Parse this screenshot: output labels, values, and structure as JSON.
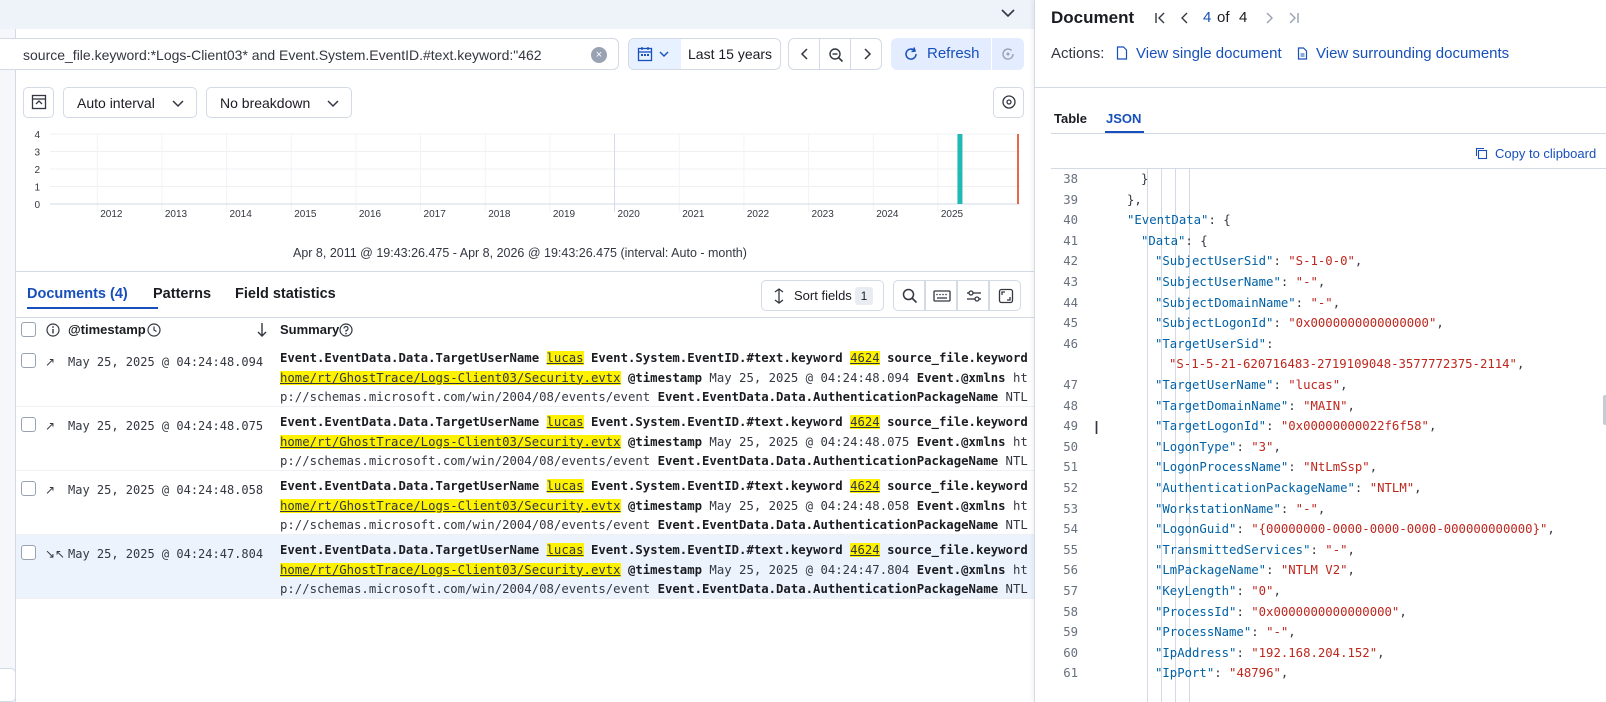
{
  "query": {
    "text": "source_file.keyword:*Logs-Client03* and Event.System.EventID.#text.keyword:\"462",
    "clear_symbol": "×"
  },
  "date": {
    "label": "Last 15 years"
  },
  "refresh": {
    "label": "Refresh"
  },
  "toolbar": {
    "interval": "Auto interval",
    "breakdown": "No breakdown"
  },
  "chart_data": {
    "type": "bar",
    "y_ticks": [
      "4",
      "3",
      "2",
      "1",
      "0"
    ],
    "categories": [
      "2012",
      "2013",
      "2014",
      "2015",
      "2016",
      "2017",
      "2018",
      "2019",
      "2020",
      "2021",
      "2022",
      "2023",
      "2024",
      "2025"
    ],
    "ylim": [
      0,
      4
    ],
    "bar": {
      "at": "2025-05",
      "value": 4,
      "color": "#20b9b4"
    },
    "now_marker_color": "#e7664c",
    "range_text": "Apr 8, 2011 @ 19:43:26.475 - Apr 8, 2026 @ 19:43:26.475 (interval: Auto - month)"
  },
  "tabs": {
    "documents": "Documents (4)",
    "patterns": "Patterns",
    "field_stats": "Field statistics"
  },
  "sort": {
    "label": "Sort fields",
    "count": "1"
  },
  "table": {
    "col_timestamp": "@timestamp",
    "col_summary": "Summary",
    "rows": [
      {
        "ts": "May 25, 2025 @ 04:24:48.094",
        "selected": false
      },
      {
        "ts": "May 25, 2025 @ 04:24:48.075",
        "selected": false
      },
      {
        "ts": "May 25, 2025 @ 04:24:48.058",
        "selected": false
      },
      {
        "ts": "May 25, 2025 @ 04:24:47.804",
        "selected": true
      }
    ],
    "summary": {
      "f1": "Event.EventData.Data.TargetUserName",
      "v1": "lucas",
      "f2": "Event.System.EventID.#text.keyword",
      "v2": "4624",
      "f3": "source_file.keyword",
      "v3a": "/",
      "v3b": "home/rt/GhostTrace/Logs-Client03/Security.evtx",
      "f4": "@timestamp",
      "f5": "Event.@xmlns",
      "v5a": "htt",
      "v5b": "p://schemas.microsoft.com/win/2004/08/events/event",
      "f6": "Event.EventData.Data.AuthenticationPackageName",
      "v6": "NTLM..."
    }
  },
  "flyout": {
    "title": "Document",
    "pager_current": "4",
    "pager_of": "of",
    "pager_total": "4",
    "actions_label": "Actions:",
    "view_single": "View single document",
    "view_surrounding": "View surrounding documents",
    "tab_table": "Table",
    "tab_json": "JSON",
    "copy": "Copy to clipboard"
  },
  "json_lines": [
    {
      "n": "38",
      "indent": 2,
      "text": "}"
    },
    {
      "n": "39",
      "indent": 1,
      "text": "},"
    },
    {
      "n": "40",
      "indent": 1,
      "key": "\"EventData\"",
      "rest": ": {"
    },
    {
      "n": "41",
      "indent": 2,
      "key": "\"Data\"",
      "rest": ": {"
    },
    {
      "n": "42",
      "indent": 3,
      "key": "\"SubjectUserSid\"",
      "val": "\"S-1-0-0\""
    },
    {
      "n": "43",
      "indent": 3,
      "key": "\"SubjectUserName\"",
      "val": "\"-\""
    },
    {
      "n": "44",
      "indent": 3,
      "key": "\"SubjectDomainName\"",
      "val": "\"-\""
    },
    {
      "n": "45",
      "indent": 3,
      "key": "\"SubjectLogonId\"",
      "val": "\"0x0000000000000000\""
    },
    {
      "n": "46",
      "indent": 3,
      "key": "\"TargetUserSid\"",
      "rest": ":"
    },
    {
      "n": "",
      "indent": 4,
      "valonly": "\"S-1-5-21-620716483-2719109048-3577772375-2114\""
    },
    {
      "n": "47",
      "indent": 3,
      "key": "\"TargetUserName\"",
      "val": "\"lucas\""
    },
    {
      "n": "48",
      "indent": 3,
      "key": "\"TargetDomainName\"",
      "val": "\"MAIN\""
    },
    {
      "n": "49",
      "indent": 3,
      "key": "\"TargetLogonId\"",
      "val": "\"0x00000000022f6f58\""
    },
    {
      "n": "50",
      "indent": 3,
      "key": "\"LogonType\"",
      "val": "\"3\""
    },
    {
      "n": "51",
      "indent": 3,
      "key": "\"LogonProcessName\"",
      "val": "\"NtLmSsp\""
    },
    {
      "n": "52",
      "indent": 3,
      "key": "\"AuthenticationPackageName\"",
      "val": "\"NTLM\""
    },
    {
      "n": "53",
      "indent": 3,
      "key": "\"WorkstationName\"",
      "val": "\"-\""
    },
    {
      "n": "54",
      "indent": 3,
      "key": "\"LogonGuid\"",
      "val": "\"{00000000-0000-0000-0000-000000000000}\""
    },
    {
      "n": "55",
      "indent": 3,
      "key": "\"TransmittedServices\"",
      "val": "\"-\""
    },
    {
      "n": "56",
      "indent": 3,
      "key": "\"LmPackageName\"",
      "val": "\"NTLM V2\""
    },
    {
      "n": "57",
      "indent": 3,
      "key": "\"KeyLength\"",
      "val": "\"0\""
    },
    {
      "n": "58",
      "indent": 3,
      "key": "\"ProcessId\"",
      "val": "\"0x0000000000000000\""
    },
    {
      "n": "59",
      "indent": 3,
      "key": "\"ProcessName\"",
      "val": "\"-\""
    },
    {
      "n": "60",
      "indent": 3,
      "key": "\"IpAddress\"",
      "val": "\"192.168.204.152\""
    },
    {
      "n": "61",
      "indent": 3,
      "key": "\"IpPort\"",
      "val": "\"48796\""
    }
  ]
}
